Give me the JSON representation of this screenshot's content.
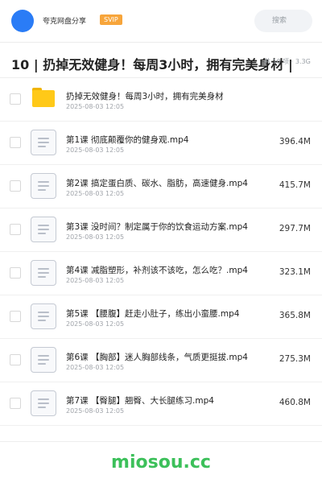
{
  "header": {
    "app_name": "夸克网盘分享",
    "badge": "SVIP",
    "search_placeholder": "搜索",
    "avatar_color": "#2a7cf6",
    "badge_color": "#f7a53b"
  },
  "title": {
    "text": "10 | 扔掉无效健身！每周3小时，拥有完美身材 |",
    "meta": "共 10 项 · 3.3G"
  },
  "files": [
    {
      "name": "扔掉无效健身！每周3小时，拥有完美身材",
      "date": "2025-08-03 12:05",
      "size": "",
      "icon": "folder-icon"
    },
    {
      "name": "第1课 彻底颠覆你的健身观.mp4",
      "date": "2025-08-03 12:05",
      "size": "396.4M",
      "icon": "video-file-icon"
    },
    {
      "name": "第2课 搞定蛋白质、碳水、脂肪，高速健身.mp4",
      "date": "2025-08-03 12:05",
      "size": "415.7M",
      "icon": "video-file-icon"
    },
    {
      "name": "第3课 没时间？制定属于你的饮食运动方案.mp4",
      "date": "2025-08-03 12:05",
      "size": "297.7M",
      "icon": "video-file-icon"
    },
    {
      "name": "第4课 减脂塑形，补剂该不该吃，怎么吃？.mp4",
      "date": "2025-08-03 12:05",
      "size": "323.1M",
      "icon": "video-file-icon"
    },
    {
      "name": "第5课 【腰腹】赶走小肚子，练出小蛮腰.mp4",
      "date": "2025-08-03 12:05",
      "size": "365.8M",
      "icon": "video-file-icon"
    },
    {
      "name": "第6课 【胸部】迷人胸部线条，气质更挺拔.mp4",
      "date": "2025-08-03 12:05",
      "size": "275.3M",
      "icon": "video-file-icon"
    },
    {
      "name": "第7课 【臀腿】翘臀、大长腿练习.mp4",
      "date": "2025-08-03 12:05",
      "size": "460.8M",
      "icon": "video-file-icon"
    }
  ],
  "watermark": "miosou.cc",
  "watermark_color": "#3cc05a"
}
